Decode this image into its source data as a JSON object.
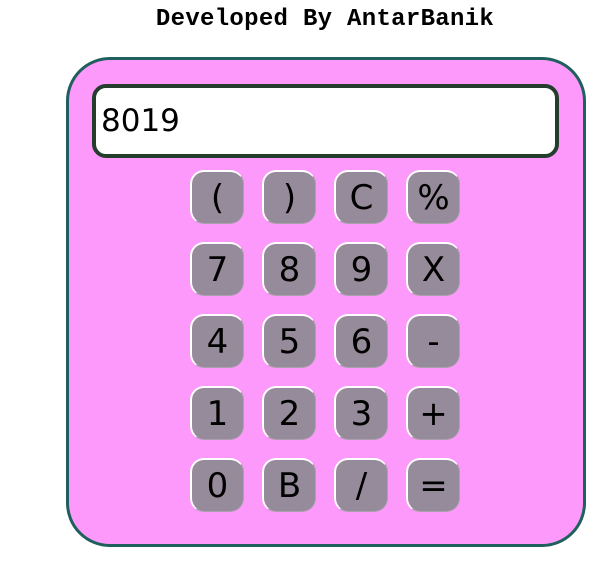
{
  "header": {
    "title": "Developed By AntarBanik"
  },
  "display": {
    "value": "8019"
  },
  "keys": [
    {
      "label": "(",
      "name": "open-paren-button"
    },
    {
      "label": ")",
      "name": "close-paren-button"
    },
    {
      "label": "C",
      "name": "clear-button"
    },
    {
      "label": "%",
      "name": "percent-button"
    },
    {
      "label": "7",
      "name": "digit-7-button"
    },
    {
      "label": "8",
      "name": "digit-8-button"
    },
    {
      "label": "9",
      "name": "digit-9-button"
    },
    {
      "label": "X",
      "name": "multiply-button"
    },
    {
      "label": "4",
      "name": "digit-4-button"
    },
    {
      "label": "5",
      "name": "digit-5-button"
    },
    {
      "label": "6",
      "name": "digit-6-button"
    },
    {
      "label": "-",
      "name": "subtract-button"
    },
    {
      "label": "1",
      "name": "digit-1-button"
    },
    {
      "label": "2",
      "name": "digit-2-button"
    },
    {
      "label": "3",
      "name": "digit-3-button"
    },
    {
      "label": "+",
      "name": "add-button"
    },
    {
      "label": "0",
      "name": "digit-0-button"
    },
    {
      "label": "B",
      "name": "backspace-button"
    },
    {
      "label": "/",
      "name": "divide-button"
    },
    {
      "label": "=",
      "name": "equals-button"
    }
  ],
  "colors": {
    "body_background": "#fe99fc",
    "body_border": "#1f5f5d",
    "display_border": "#253d2c",
    "key_background": "#968b9a"
  }
}
